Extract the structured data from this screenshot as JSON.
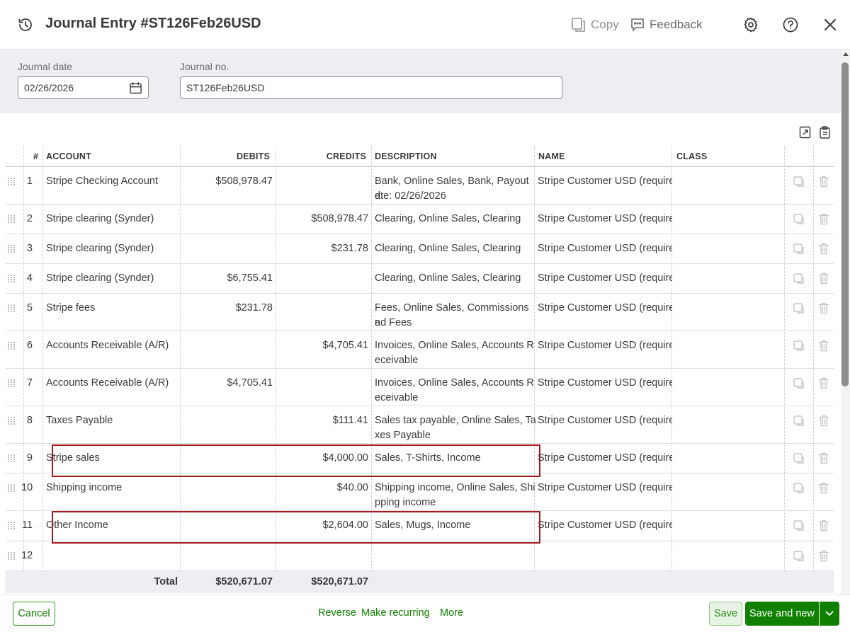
{
  "header": {
    "title": "Journal Entry #ST126Feb26USD",
    "copy_label": "Copy",
    "feedback_label": "Feedback"
  },
  "form": {
    "journal_date_label": "Journal date",
    "journal_date_value": "02/26/2026",
    "journal_no_label": "Journal no.",
    "journal_no_value": "ST126Feb26USD"
  },
  "table": {
    "columns": {
      "num": "#",
      "account": "ACCOUNT",
      "debits": "DEBITS",
      "credits": "CREDITS",
      "description": "DESCRIPTION",
      "name": "NAME",
      "class": "CLASS"
    },
    "rows": [
      {
        "num": "1",
        "account": "Stripe Checking Account",
        "debit": "$508,978.47",
        "credit": "",
        "desc1": "Bank, Online Sales, Bank, Payout d",
        "desc2": "ate: 02/26/2026",
        "name": "Stripe Customer USD (require",
        "class": ""
      },
      {
        "num": "2",
        "account": "Stripe clearing (Synder)",
        "debit": "",
        "credit": "$508,978.47",
        "desc1": "Clearing, Online Sales, Clearing",
        "desc2": "",
        "name": "Stripe Customer USD (require",
        "class": ""
      },
      {
        "num": "3",
        "account": "Stripe clearing (Synder)",
        "debit": "",
        "credit": "$231.78",
        "desc1": "Clearing, Online Sales, Clearing",
        "desc2": "",
        "name": "Stripe Customer USD (require",
        "class": ""
      },
      {
        "num": "4",
        "account": "Stripe clearing (Synder)",
        "debit": "$6,755.41",
        "credit": "",
        "desc1": "Clearing, Online Sales, Clearing",
        "desc2": "",
        "name": "Stripe Customer USD (require",
        "class": ""
      },
      {
        "num": "5",
        "account": "Stripe fees",
        "debit": "$231.78",
        "credit": "",
        "desc1": "Fees, Online Sales, Commissions a",
        "desc2": "nd Fees",
        "name": "Stripe Customer USD (require",
        "class": ""
      },
      {
        "num": "6",
        "account": "Accounts Receivable (A/R)",
        "debit": "",
        "credit": "$4,705.41",
        "desc1": "Invoices, Online Sales, Accounts R",
        "desc2": "eceivable",
        "name": "Stripe Customer USD (require",
        "class": ""
      },
      {
        "num": "7",
        "account": "Accounts Receivable (A/R)",
        "debit": "$4,705.41",
        "credit": "",
        "desc1": "Invoices, Online Sales, Accounts R",
        "desc2": "eceivable",
        "name": "Stripe Customer USD (require",
        "class": ""
      },
      {
        "num": "8",
        "account": "Taxes Payable",
        "debit": "",
        "credit": "$111.41",
        "desc1": "Sales tax payable, Online Sales, Ta",
        "desc2": "xes Payable",
        "name": "Stripe Customer USD (require",
        "class": ""
      },
      {
        "num": "9",
        "account": "Stripe sales",
        "debit": "",
        "credit": "$4,000.00",
        "desc1": "Sales, T-Shirts, Income",
        "desc2": "",
        "name": "Stripe Customer USD (require",
        "class": ""
      },
      {
        "num": "10",
        "account": "Shipping income",
        "debit": "",
        "credit": "$40.00",
        "desc1": "Shipping income, Online Sales, Shi",
        "desc2": "pping income",
        "name": "Stripe Customer USD (require",
        "class": ""
      },
      {
        "num": "11",
        "account": "Other Income",
        "debit": "",
        "credit": "$2,604.00",
        "desc1": "Sales, Mugs, Income",
        "desc2": "",
        "name": "Stripe Customer USD (require",
        "class": ""
      },
      {
        "num": "12",
        "account": "",
        "debit": "",
        "credit": "",
        "desc1": "",
        "desc2": "",
        "name": "",
        "class": ""
      }
    ],
    "totals": {
      "label": "Total",
      "debits": "$520,671.07",
      "credits": "$520,671.07"
    }
  },
  "footer": {
    "cancel": "Cancel",
    "reverse": "Reverse",
    "make_recurring": "Make recurring",
    "more": "More",
    "save": "Save",
    "save_and_new": "Save and new"
  },
  "colors": {
    "brand_green": "#108000",
    "highlight_red": "#a01c1c",
    "panel_gray": "#eceef1"
  },
  "icons": [
    "history-icon",
    "copy-icon",
    "feedback-icon",
    "gear-icon",
    "help-icon",
    "close-icon",
    "calendar-icon",
    "export-icon",
    "paste-icon",
    "drag-handle-icon",
    "duplicate-icon",
    "trash-icon",
    "chevron-down-icon"
  ]
}
